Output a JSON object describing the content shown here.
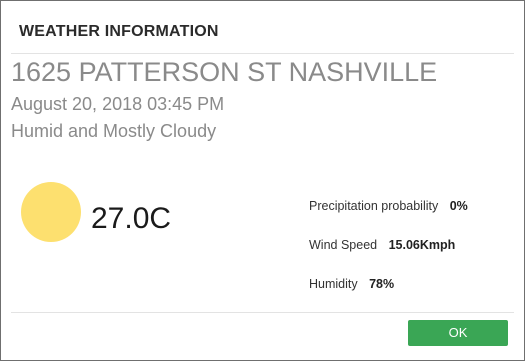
{
  "dialog": {
    "title": "WEATHER INFORMATION"
  },
  "location": {
    "address": "1625 PATTERSON ST NASHVILLE",
    "datetime": "August 20, 2018 03:45 PM",
    "condition": "Humid and Mostly Cloudy"
  },
  "weather": {
    "icon": "sun-icon",
    "icon_color": "#fde06f",
    "temperature": "27.0C"
  },
  "stats": {
    "precipitation_label": "Precipitation probability",
    "precipitation_value": "0%",
    "wind_label": "Wind Speed",
    "wind_value": "15.06Kmph",
    "humidity_label": "Humidity",
    "humidity_value": "78%"
  },
  "footer": {
    "ok_label": "OK",
    "ok_color": "#3aa655"
  }
}
